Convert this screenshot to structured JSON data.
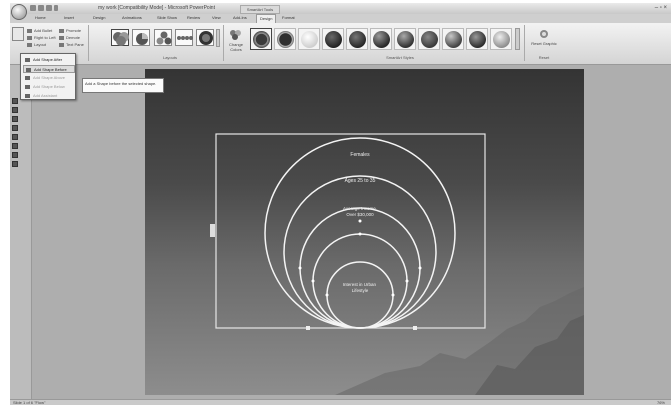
{
  "window": {
    "title": "my work [Compatibility Mode] - Microsoft PowerPoint",
    "contextual_tools_label": "SmartArt Tools",
    "controls": "– ▫ ×"
  },
  "tabs": [
    "Home",
    "Insert",
    "Design",
    "Animations",
    "Slide Show",
    "Review",
    "View",
    "Add-Ins",
    "Design",
    "Format"
  ],
  "ribbon": {
    "add_bullet": "Add Bullet",
    "right_to_left": "Right to Left",
    "layout": "Layout",
    "promote": "Promote",
    "demote": "Demote",
    "text_pane": "Text Pane",
    "change_colors": "Change Colors",
    "reset_graphic": "Reset Graphic",
    "groups": {
      "layouts": "Layouts",
      "styles": "SmartArt Styles",
      "reset": "Reset"
    },
    "colors": {
      "style_dark": "#3b3b3b",
      "style_light": "#e9e9e9"
    }
  },
  "add_shape_menu": {
    "items": [
      {
        "label": "Add Shape After",
        "enabled": true
      },
      {
        "label": "Add Shape Before",
        "enabled": true,
        "highlighted": true
      },
      {
        "label": "Add Shape Above",
        "enabled": false
      },
      {
        "label": "Add Shape Below",
        "enabled": false
      },
      {
        "label": "Add Assistant",
        "enabled": false
      }
    ],
    "tooltip": "Add a Shape before the selected shape."
  },
  "smartart": {
    "labels": [
      "Females",
      "Ages 25 to 35",
      "Average Income Over $30,000",
      "Interest in Urban Lifestyle"
    ]
  },
  "status": {
    "left": "Slide 1 of 6   \"Flow\"",
    "zoom": "76%"
  }
}
